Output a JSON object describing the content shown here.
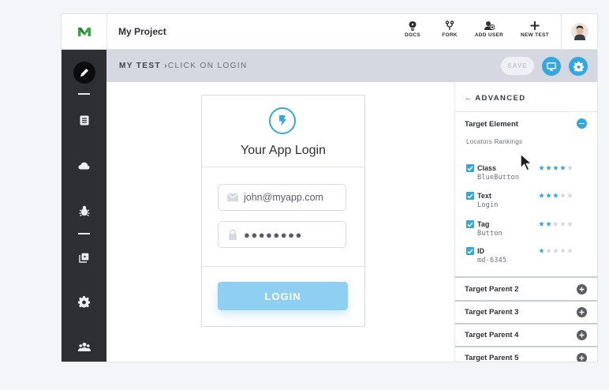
{
  "topbar": {
    "project_name": "My Project",
    "buttons": [
      {
        "label": "DOCS",
        "icon": "lightbulb-icon"
      },
      {
        "label": "FORK",
        "icon": "fork-icon"
      },
      {
        "label": "ADD USER",
        "icon": "add-user-icon"
      },
      {
        "label": "NEW TEST",
        "icon": "plus-icon"
      }
    ]
  },
  "sidebar": {
    "items": [
      "edit-icon",
      "list-icon",
      "cloud-icon",
      "bug-icon",
      "copy-icon",
      "gear-icon",
      "team-icon"
    ]
  },
  "header": {
    "breadcrumb_root": "MY TEST",
    "breadcrumb_separator": "›",
    "breadcrumb_current": "CLICK ON LOGIN",
    "save_label": "SAVE"
  },
  "login_card": {
    "title": "Your App Login",
    "email_value": "john@myapp.com",
    "password_value": "●●●●●●●●",
    "button_label": "LOGIN"
  },
  "panel": {
    "back_label": "ADVANCED",
    "target_element_label": "Target Element",
    "locators_heading": "Locators Rankings",
    "locators": [
      {
        "name": "Class",
        "value": "BlueButton",
        "rating": 4
      },
      {
        "name": "Text",
        "value": "Login",
        "rating": 3
      },
      {
        "name": "Tag",
        "value": "Button",
        "rating": 2
      },
      {
        "name": "ID",
        "value": "md-6345",
        "rating": 1
      }
    ],
    "target_parents": [
      "Target Parent 2",
      "Target Parent 3",
      "Target Parent 4",
      "Target Parent 5"
    ]
  },
  "colors": {
    "accent": "#34a7df",
    "sidebar": "#2e2f33",
    "header_strip": "#d5d8e1",
    "login_button": "#8fd0f2",
    "logo_green": "#3fa34d"
  }
}
